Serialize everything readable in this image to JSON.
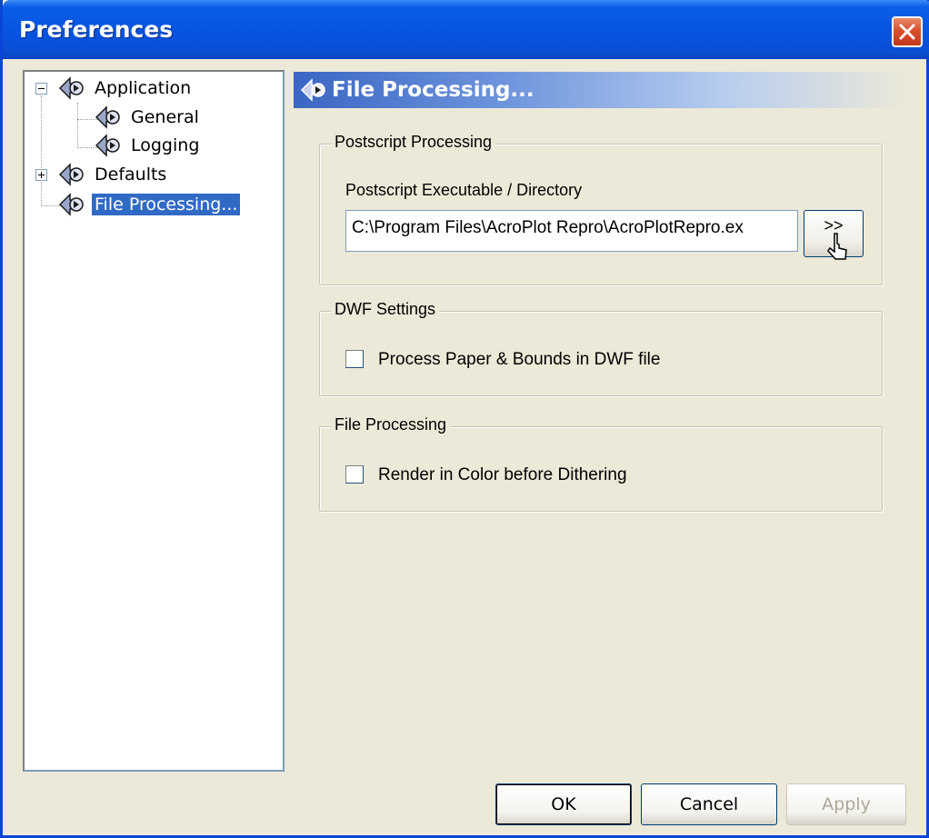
{
  "window": {
    "title": "Preferences"
  },
  "tree": {
    "items": [
      {
        "label": "Application",
        "expander": "minus",
        "children": [
          {
            "label": "General"
          },
          {
            "label": "Logging"
          }
        ]
      },
      {
        "label": "Defaults",
        "expander": "plus"
      },
      {
        "label": "File Processing...",
        "selected": true
      }
    ]
  },
  "panel": {
    "title": "File Processing...",
    "postscript": {
      "group_title": "Postscript Processing",
      "field_label": "Postscript Executable / Directory",
      "path_value": "C:\\Program Files\\AcroPlot Repro\\AcroPlotRepro.ex",
      "browse_label": ">>"
    },
    "dwf": {
      "group_title": "DWF Settings",
      "checkbox_label": "Process Paper & Bounds in DWF file",
      "checked": false
    },
    "file_processing": {
      "group_title": "File Processing",
      "checkbox_label": "Render in Color before Dithering",
      "checked": false
    }
  },
  "buttons": {
    "ok": "OK",
    "cancel": "Cancel",
    "apply": "Apply"
  },
  "colors": {
    "titlebar": "#0854e0",
    "selection": "#316ac5",
    "dialog_bg": "#ece9d8",
    "close": "#d9502e"
  }
}
